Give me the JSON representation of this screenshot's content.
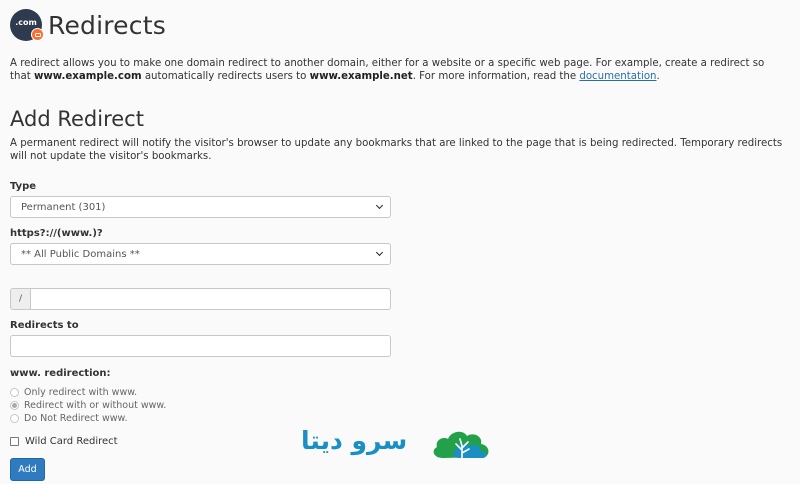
{
  "header": {
    "icon_label": ".com",
    "title": "Redirects"
  },
  "intro": {
    "part1": "A redirect allows you to make one domain redirect to another domain, either for a website or a specific web page. For example, create a redirect so that ",
    "example_com": "www.example.com",
    "part2": " automatically redirects users to ",
    "example_net": "www.example.net",
    "part3": ". For more information, read the ",
    "doc_link": "documentation",
    "part4": "."
  },
  "add_redirect": {
    "title": "Add Redirect",
    "description": "A permanent redirect will notify the visitor's browser to update any bookmarks that are linked to the page that is being redirected. Temporary redirects will not update the visitor's bookmarks."
  },
  "form": {
    "type_label": "Type",
    "type_value": "Permanent (301)",
    "domain_label": "https?://(www.)?",
    "domain_value": "** All Public Domains **",
    "path_prefix": "/",
    "path_value": "",
    "redirects_to_label": "Redirects to",
    "redirects_to_value": "",
    "www_label": "www. redirection:",
    "www_options": [
      {
        "label": "Only redirect with www.",
        "checked": false
      },
      {
        "label": "Redirect with or without www.",
        "checked": true
      },
      {
        "label": "Do Not Redirect www.",
        "checked": false
      }
    ],
    "wildcard_label": "Wild Card Redirect",
    "wildcard_checked": false,
    "add_button": "Add"
  },
  "watermark": {
    "text": "سرو دیتا"
  },
  "colors": {
    "primary_button": "#2f7bbf",
    "link": "#2a6ead",
    "icon_bg": "#2e3a4e",
    "icon_badge": "#ff6c2c",
    "watermark": "#1a8fc4"
  }
}
